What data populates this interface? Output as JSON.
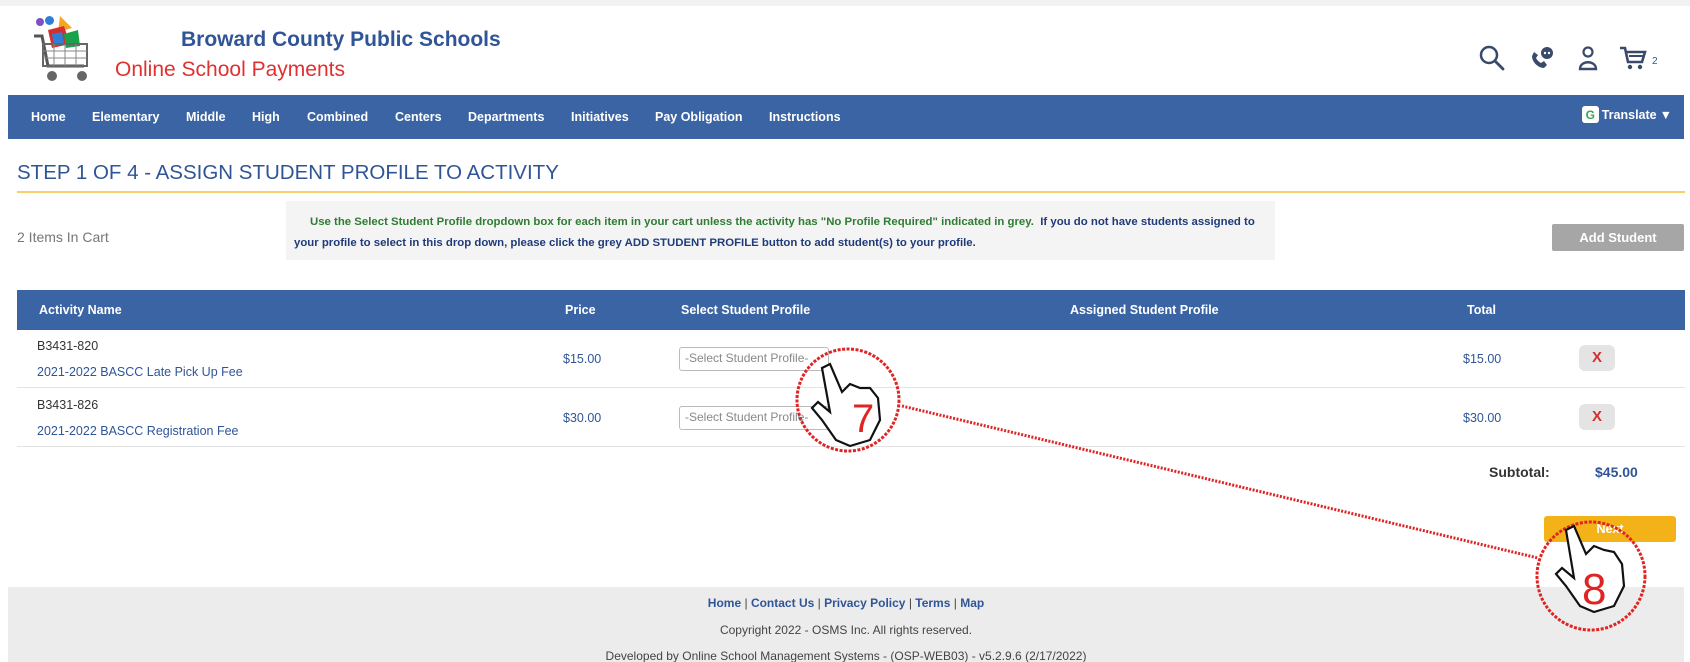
{
  "header": {
    "title": "Broward County Public Schools",
    "subtitle": "Online School Payments",
    "cart_count": "2",
    "icons": [
      "search-icon",
      "support-icon",
      "user-icon",
      "cart-icon"
    ]
  },
  "nav": {
    "items": [
      "Home",
      "Elementary",
      "Middle",
      "High",
      "Combined",
      "Centers",
      "Departments",
      "Initiatives",
      "Pay Obligation",
      "Instructions"
    ],
    "translate_label": "Translate",
    "translate_g": "G"
  },
  "page": {
    "step_title": "STEP 1 OF 4 - ASSIGN STUDENT PROFILE TO ACTIVITY",
    "items_in_cart": "2 Items In Cart",
    "notice_line1": "Use the Select Student Profile dropdown box for each item in your cart unless the activity has \"No Profile Required\" indicated in grey.",
    "notice_line2a": "If you do not have students assigned to",
    "notice_line2b": "your profile to select in this drop down, please click the grey ADD STUDENT PROFILE button to add student(s) to your profile.",
    "add_student_label": "Add Student"
  },
  "table": {
    "headers": [
      "Activity Name",
      "Price",
      "Select Student Profile",
      "Assigned Student Profile",
      "Total"
    ],
    "rows": [
      {
        "code": "B3431-820",
        "name": "2021-2022 BASCC Late Pick Up Fee",
        "price": "$15.00",
        "select_placeholder": "-Select Student Profile-",
        "assigned": "",
        "total": "$15.00",
        "remove": "X"
      },
      {
        "code": "B3431-826",
        "name": "2021-2022 BASCC Registration Fee",
        "price": "$30.00",
        "select_placeholder": "-Select Student Profile-",
        "assigned": "",
        "total": "$30.00",
        "remove": "X"
      }
    ],
    "subtotal_label": "Subtotal:",
    "subtotal_value": "$45.00"
  },
  "next_label": "Next",
  "footer": {
    "links": [
      "Home",
      "Contact Us",
      "Privacy Policy",
      "Terms",
      "Map"
    ],
    "copyright": "Copyright 2022 - OSMS Inc. All rights reserved.",
    "developed": "Developed by Online School Management Systems - (OSP-WEB03) - v5.2.9.6 (2/17/2022)"
  },
  "annotations": {
    "step7": "7",
    "step8": "8",
    "color": "#e02424"
  },
  "colors": {
    "brand_blue": "#2f5597",
    "nav_blue": "#3a64a4",
    "brand_red": "#e03131",
    "next_yellow": "#f3b318",
    "notice_green": "#2e7d32"
  }
}
